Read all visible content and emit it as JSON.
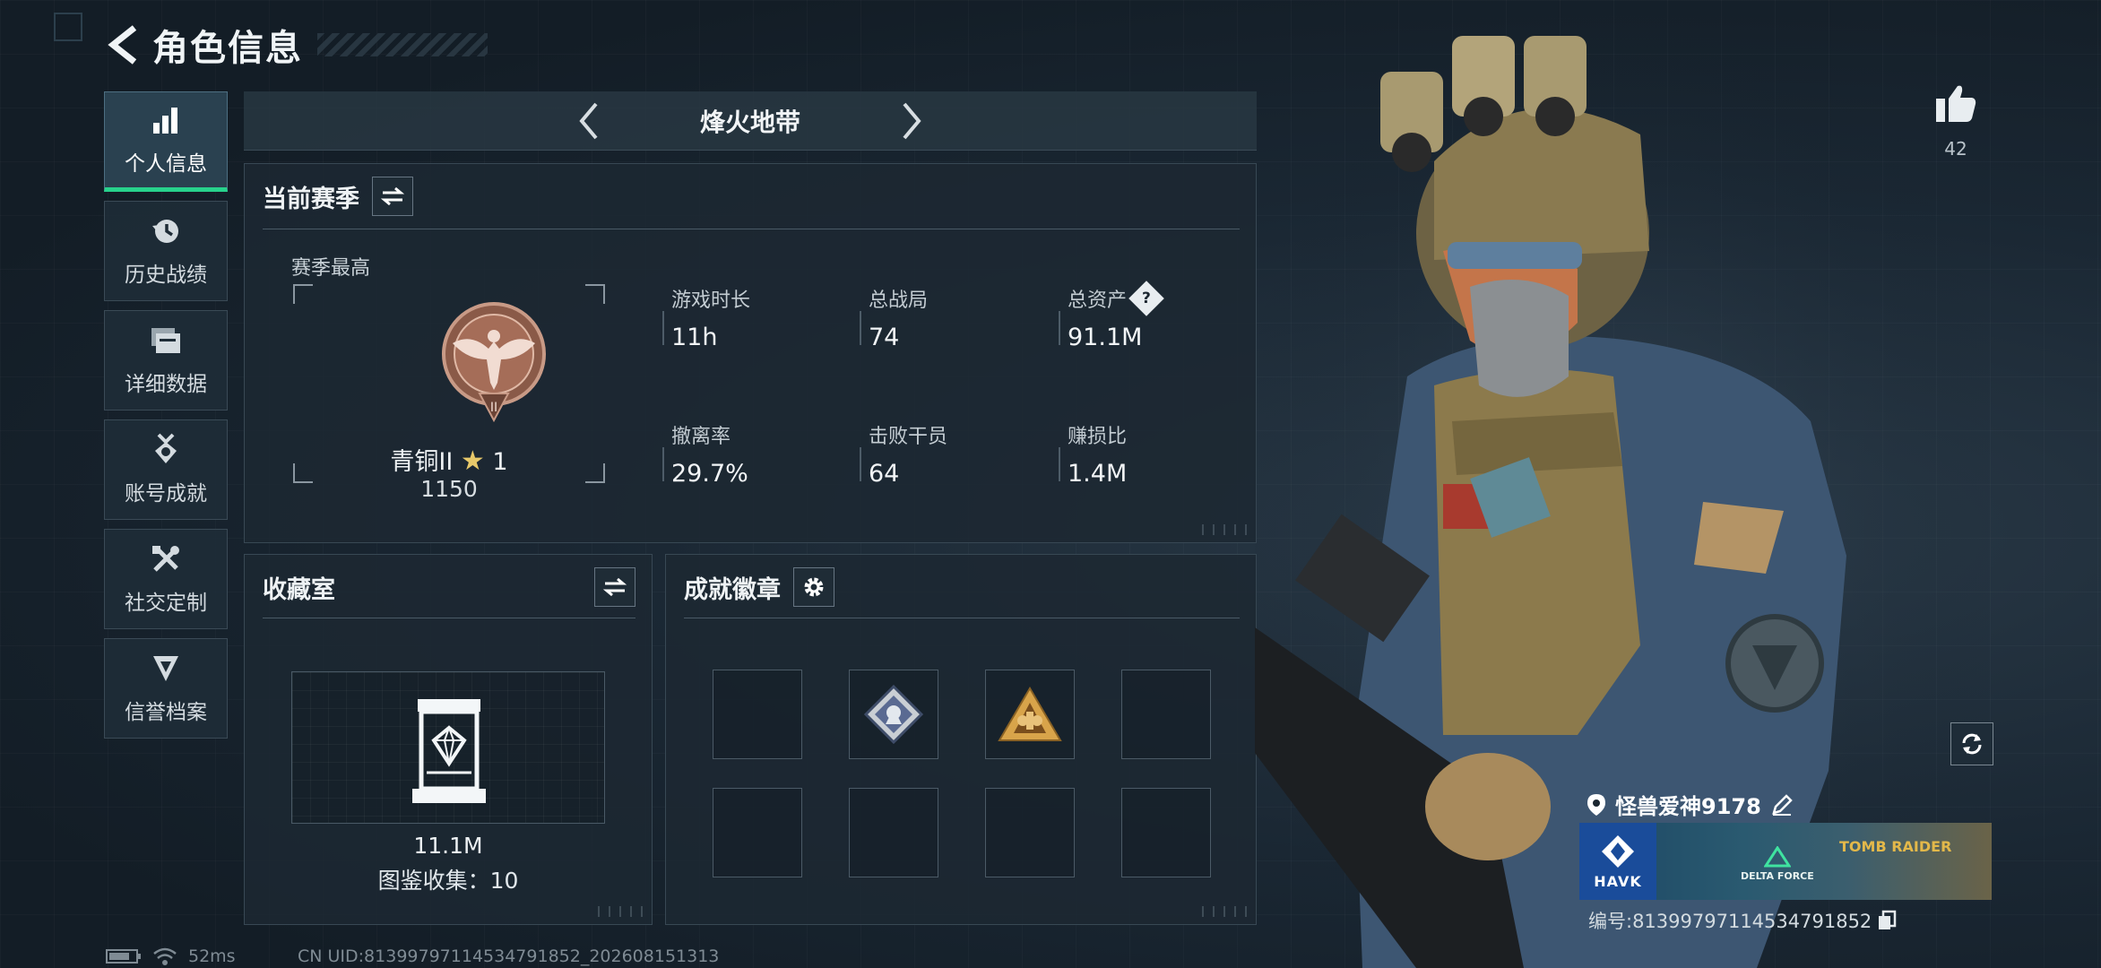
{
  "header": {
    "title": "角色信息"
  },
  "sidebar": {
    "items": [
      {
        "label": "个人信息",
        "icon": "bar-chart-icon",
        "active": true
      },
      {
        "label": "历史战绩",
        "icon": "history-clock-icon",
        "active": false
      },
      {
        "label": "详细数据",
        "icon": "folder-icon",
        "active": false
      },
      {
        "label": "账号成就",
        "icon": "medal-icon",
        "active": false
      },
      {
        "label": "社交定制",
        "icon": "tools-icon",
        "active": false
      },
      {
        "label": "信誉档案",
        "icon": "shield-emblem-icon",
        "active": false
      }
    ]
  },
  "mode": {
    "label": "烽火地带"
  },
  "season": {
    "title": "当前赛季",
    "subtitle": "赛季最高",
    "rank_name": "青铜II",
    "rank_stars": "1",
    "rank_score": "1150",
    "stats": [
      {
        "label": "游戏时长",
        "value": "11h"
      },
      {
        "label": "总战局",
        "value": "74"
      },
      {
        "label": "总资产",
        "value": "91.1M",
        "help": "?"
      },
      {
        "label": "撤离率",
        "value": "29.7%"
      },
      {
        "label": "击败干员",
        "value": "64"
      },
      {
        "label": "赚损比",
        "value": "1.4M"
      }
    ]
  },
  "collection": {
    "title": "收藏室",
    "value": "11.1M",
    "count_text": "图鉴收集：10"
  },
  "badges": {
    "title": "成就徽章",
    "slots": [
      "empty",
      "blue-badge",
      "gold-badge",
      "empty",
      "empty",
      "empty",
      "empty",
      "empty"
    ]
  },
  "player": {
    "likes": "42",
    "name": "怪兽爱神9178",
    "id": "编号:8139979711453479185​2",
    "banner": {
      "logo": "HAVK",
      "game": "DELTA FORCE",
      "event": "TOMB RAIDER"
    }
  },
  "status": {
    "ping": "52ms",
    "uid": "CN UID:81399797114534791852_202608151313"
  },
  "colors": {
    "accent": "#27d28c",
    "panel": "#1c2832",
    "text": "#eef2f4"
  }
}
